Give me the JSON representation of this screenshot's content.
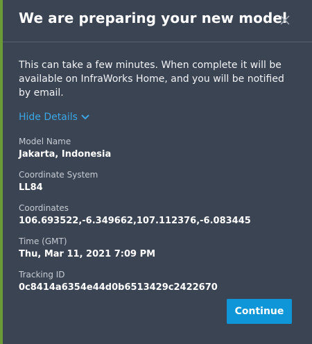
{
  "dialog": {
    "title": "We are preparing your new model",
    "message": "This can take a few minutes. When complete it will be available on InfraWorks Home, and you will be notified by email.",
    "toggle_label": "Hide Details",
    "continue_label": "Continue",
    "close_icon": "close-icon",
    "toggle_icon": "chevron-down-icon"
  },
  "details": [
    {
      "label": "Model Name",
      "value": "Jakarta, Indonesia"
    },
    {
      "label": "Coordinate System",
      "value": "LL84"
    },
    {
      "label": "Coordinates",
      "value": "106.693522,-6.349662,107.112376,-6.083445"
    },
    {
      "label": "Time (GMT)",
      "value": "Thu, Mar 11, 2021 7:09 PM"
    },
    {
      "label": "Tracking ID",
      "value": "0c8414a6354e44d0b6513429c2422670"
    }
  ],
  "colors": {
    "background": "#3b4453",
    "accent": "#6b9b36",
    "link": "#3ba7e5",
    "primary_button": "#0f96d8"
  }
}
